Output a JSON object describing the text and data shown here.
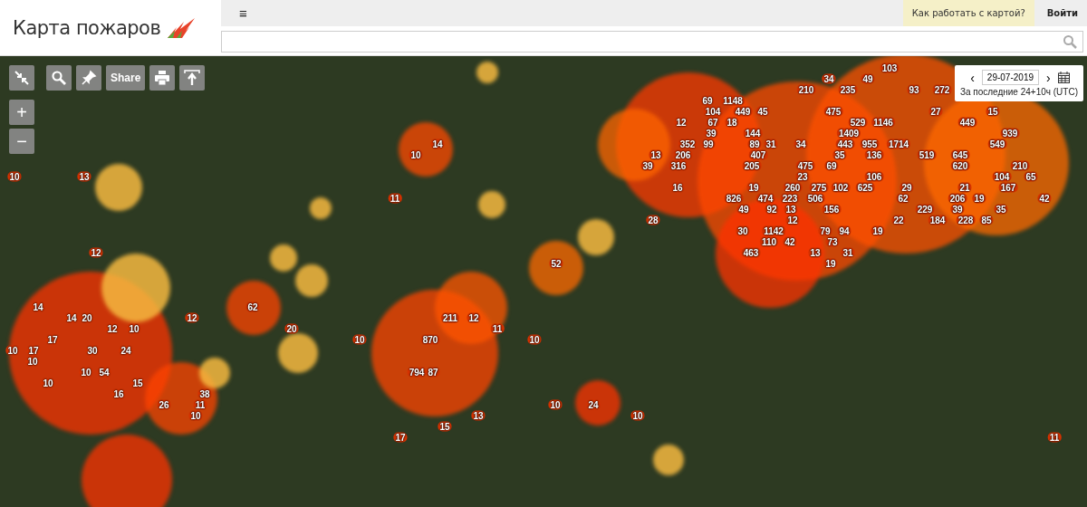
{
  "header": {
    "logo": "Карта пожаров",
    "menu_button": "≡",
    "help_link": "Как работать с картой?",
    "login": "Войти"
  },
  "map_controls": {
    "share": "Share",
    "zoom_in": "+",
    "zoom_out": "−"
  },
  "date_picker": {
    "prev": "‹",
    "date": "29-07-2019",
    "next": "›",
    "period": "За последние 24+10ч (UTC)"
  },
  "fires": [
    {
      "count": "103"
    },
    {
      "count": "34"
    },
    {
      "count": "49"
    },
    {
      "count": "210"
    },
    {
      "count": "235"
    },
    {
      "count": "93"
    },
    {
      "count": "272"
    },
    {
      "count": "69"
    },
    {
      "count": "1148"
    },
    {
      "count": "104"
    },
    {
      "count": "449"
    },
    {
      "count": "45"
    },
    {
      "count": "475"
    },
    {
      "count": "27"
    },
    {
      "count": "15"
    },
    {
      "count": "12"
    },
    {
      "count": "67"
    },
    {
      "count": "18"
    },
    {
      "count": "529"
    },
    {
      "count": "1146"
    },
    {
      "count": "449"
    },
    {
      "count": "39"
    },
    {
      "count": "144"
    },
    {
      "count": "1409"
    },
    {
      "count": "939"
    },
    {
      "count": "14"
    },
    {
      "count": "352"
    },
    {
      "count": "99"
    },
    {
      "count": "89"
    },
    {
      "count": "31"
    },
    {
      "count": "34"
    },
    {
      "count": "443"
    },
    {
      "count": "955"
    },
    {
      "count": "1714"
    },
    {
      "count": "549"
    },
    {
      "count": "10"
    },
    {
      "count": "13"
    },
    {
      "count": "206"
    },
    {
      "count": "407"
    },
    {
      "count": "35"
    },
    {
      "count": "136"
    },
    {
      "count": "519"
    },
    {
      "count": "645"
    },
    {
      "count": "39"
    },
    {
      "count": "316"
    },
    {
      "count": "205"
    },
    {
      "count": "475"
    },
    {
      "count": "69"
    },
    {
      "count": "620"
    },
    {
      "count": "210"
    },
    {
      "count": "10"
    },
    {
      "count": "13"
    },
    {
      "count": "23"
    },
    {
      "count": "106"
    },
    {
      "count": "104"
    },
    {
      "count": "65"
    },
    {
      "count": "16"
    },
    {
      "count": "19"
    },
    {
      "count": "260"
    },
    {
      "count": "275"
    },
    {
      "count": "102"
    },
    {
      "count": "625"
    },
    {
      "count": "29"
    },
    {
      "count": "21"
    },
    {
      "count": "167"
    },
    {
      "count": "11"
    },
    {
      "count": "826"
    },
    {
      "count": "474"
    },
    {
      "count": "223"
    },
    {
      "count": "506"
    },
    {
      "count": "62"
    },
    {
      "count": "206"
    },
    {
      "count": "19"
    },
    {
      "count": "42"
    },
    {
      "count": "49"
    },
    {
      "count": "92"
    },
    {
      "count": "13"
    },
    {
      "count": "156"
    },
    {
      "count": "229"
    },
    {
      "count": "39"
    },
    {
      "count": "35"
    },
    {
      "count": "28"
    },
    {
      "count": "12"
    },
    {
      "count": "22"
    },
    {
      "count": "184"
    },
    {
      "count": "228"
    },
    {
      "count": "85"
    },
    {
      "count": "30"
    },
    {
      "count": "1142"
    },
    {
      "count": "79"
    },
    {
      "count": "94"
    },
    {
      "count": "19"
    },
    {
      "count": "110"
    },
    {
      "count": "42"
    },
    {
      "count": "73"
    },
    {
      "count": "12"
    },
    {
      "count": "463"
    },
    {
      "count": "13"
    },
    {
      "count": "31"
    },
    {
      "count": "52"
    },
    {
      "count": "19"
    },
    {
      "count": "14"
    },
    {
      "count": "62"
    },
    {
      "count": "14"
    },
    {
      "count": "20"
    },
    {
      "count": "12"
    },
    {
      "count": "211"
    },
    {
      "count": "12"
    },
    {
      "count": "12"
    },
    {
      "count": "10"
    },
    {
      "count": "20"
    },
    {
      "count": "11"
    },
    {
      "count": "17"
    },
    {
      "count": "10"
    },
    {
      "count": "870"
    },
    {
      "count": "10"
    },
    {
      "count": "10"
    },
    {
      "count": "17"
    },
    {
      "count": "30"
    },
    {
      "count": "24"
    },
    {
      "count": "10"
    },
    {
      "count": "10"
    },
    {
      "count": "54"
    },
    {
      "count": "794"
    },
    {
      "count": "87"
    },
    {
      "count": "10"
    },
    {
      "count": "15"
    },
    {
      "count": "16"
    },
    {
      "count": "38"
    },
    {
      "count": "26"
    },
    {
      "count": "11"
    },
    {
      "count": "10"
    },
    {
      "count": "24"
    },
    {
      "count": "10"
    },
    {
      "count": "13"
    },
    {
      "count": "10"
    },
    {
      "count": "15"
    },
    {
      "count": "17"
    },
    {
      "count": "11"
    }
  ]
}
